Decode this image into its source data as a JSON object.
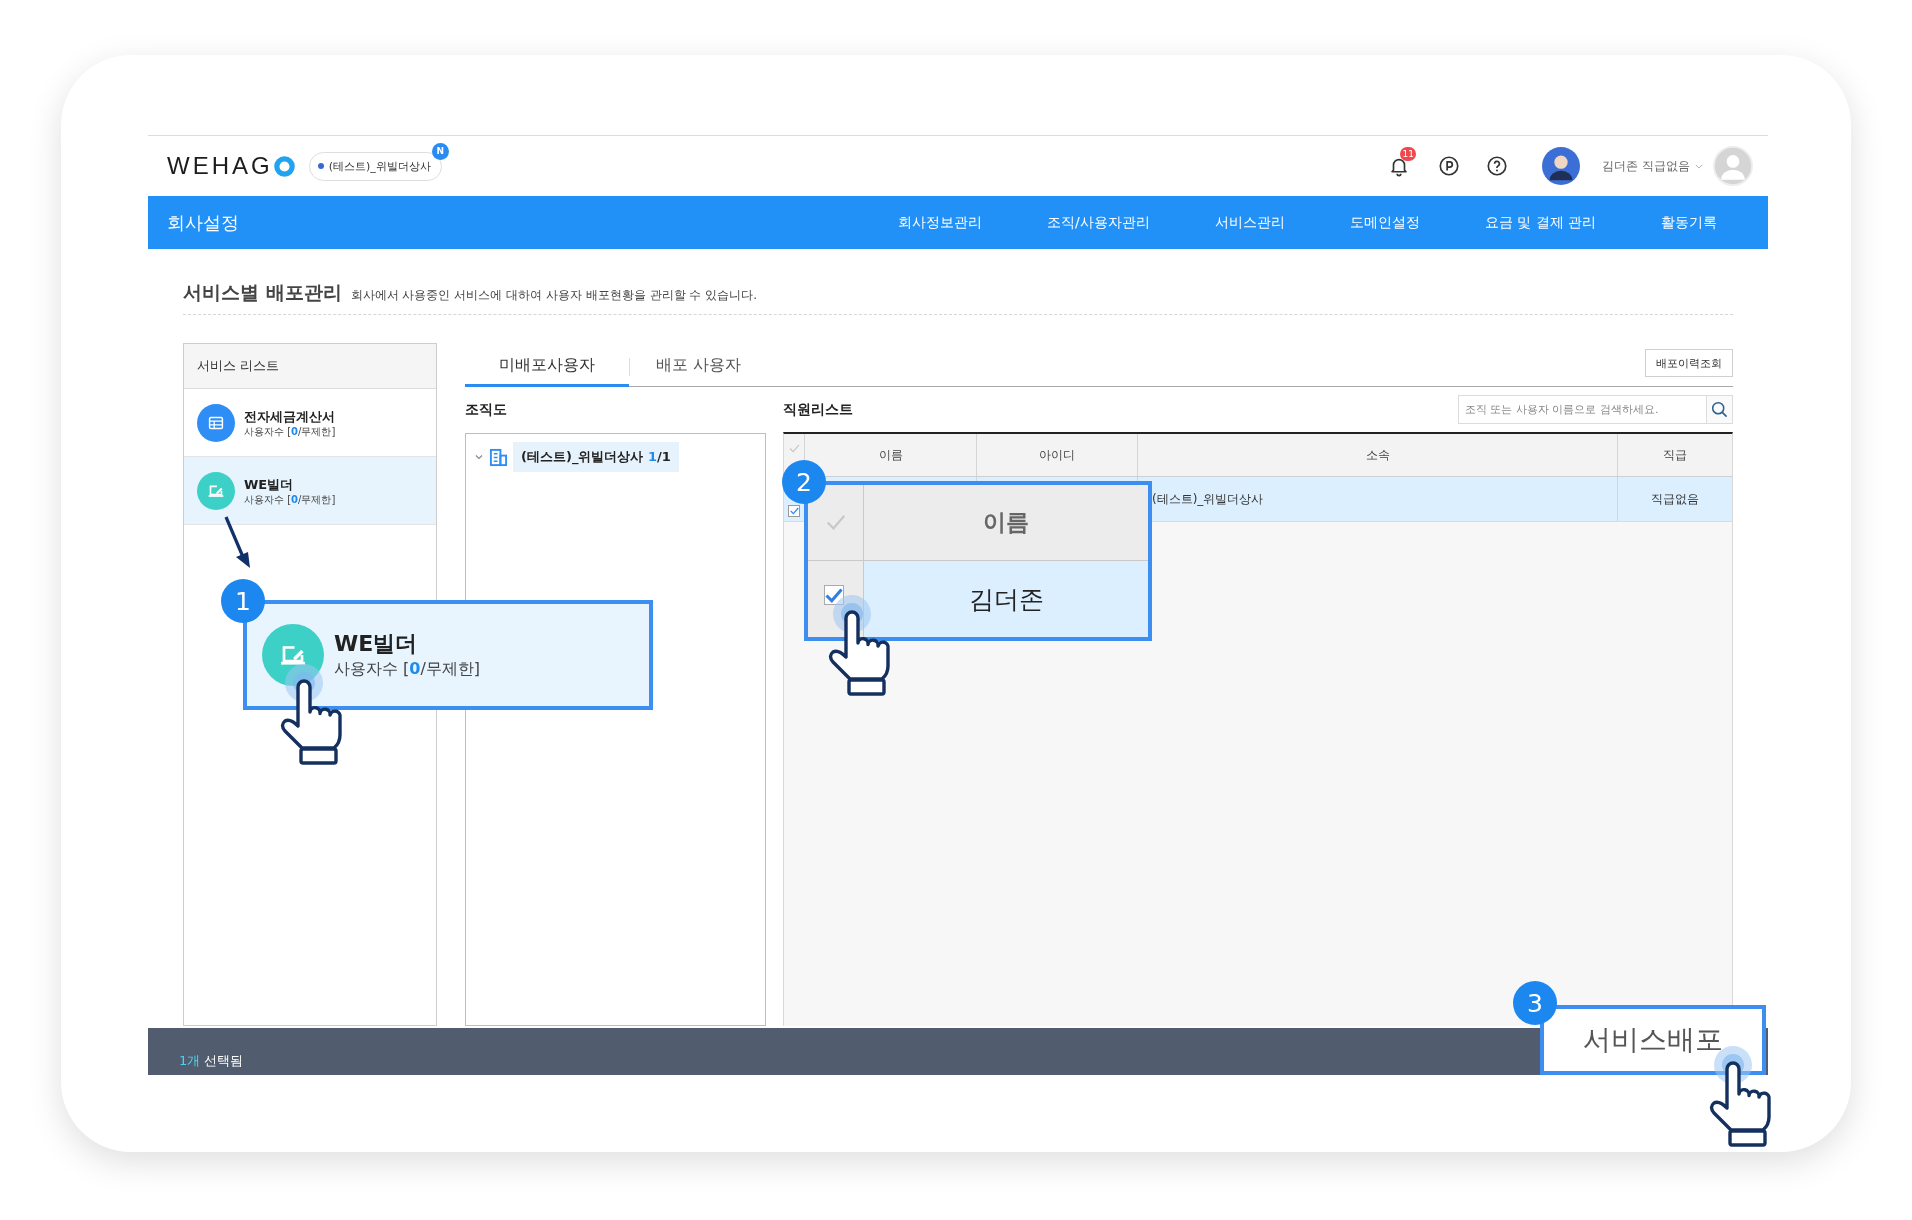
{
  "header": {
    "logo": "WEHAG",
    "company": {
      "label": "(테스트)_위빌더상사",
      "badge": "N"
    },
    "notification_count": "11",
    "user_name": "김더존 직급없음"
  },
  "nav": {
    "title": "회사설정",
    "items": [
      {
        "label": "회사정보관리"
      },
      {
        "label": "조직/사용자관리"
      },
      {
        "label": "서비스관리"
      },
      {
        "label": "도메인설정"
      },
      {
        "label": "요금 및 결제 관리"
      },
      {
        "label": "활동기록"
      }
    ]
  },
  "page": {
    "title": "서비스별 배포관리",
    "description": "회사에서 사용중인 서비스에 대하여 사용자 배포현황을 관리할 수 있습니다."
  },
  "service_list": {
    "title": "서비스 리스트",
    "items": [
      {
        "kind": "invoice",
        "name": "전자세금계산서",
        "usage_label": "사용자수 [",
        "used": "0",
        "limit": "/무제한]",
        "color": "#2e8ef5",
        "selected": false
      },
      {
        "kind": "builder",
        "name": "WE빌더",
        "usage_label": "사용자수 [",
        "used": "0",
        "limit": "/무제한]",
        "color": "#3dd0c6",
        "selected": true
      }
    ]
  },
  "tabs": [
    {
      "label": "미배포사용자",
      "selected": true
    },
    {
      "label": "배포 사용자",
      "selected": false
    }
  ],
  "history_button": "배포이력조회",
  "org_chart": {
    "title": "조직도",
    "tree": [
      {
        "label": "(테스트)_위빌더상사",
        "count": "1",
        "total": "/1",
        "expanded": true,
        "selected": true
      }
    ]
  },
  "employee_list": {
    "title": "직원리스트",
    "search": {
      "placeholder": "조직 또는 사용자 이름으로 검색하세요."
    },
    "columns": [
      "이름",
      "아이디",
      "소속",
      "직급"
    ],
    "rows": [
      {
        "selected": true,
        "affiliation": "(테스트)_위빌더상사",
        "rank": "직급없음"
      }
    ]
  },
  "footer": {
    "count": "1개",
    "label": "선택됨"
  },
  "callouts": [
    {
      "number": "1",
      "kind": "service",
      "color": "#3dd0c6",
      "title": "WE빌더",
      "usage_label": "사용자수 [",
      "used": "0",
      "limit": "/무제한]"
    },
    {
      "number": "2",
      "kind": "table",
      "header": "이름",
      "value": "김더존",
      "checked": true
    },
    {
      "number": "3",
      "kind": "button",
      "label": "서비스배포"
    }
  ]
}
